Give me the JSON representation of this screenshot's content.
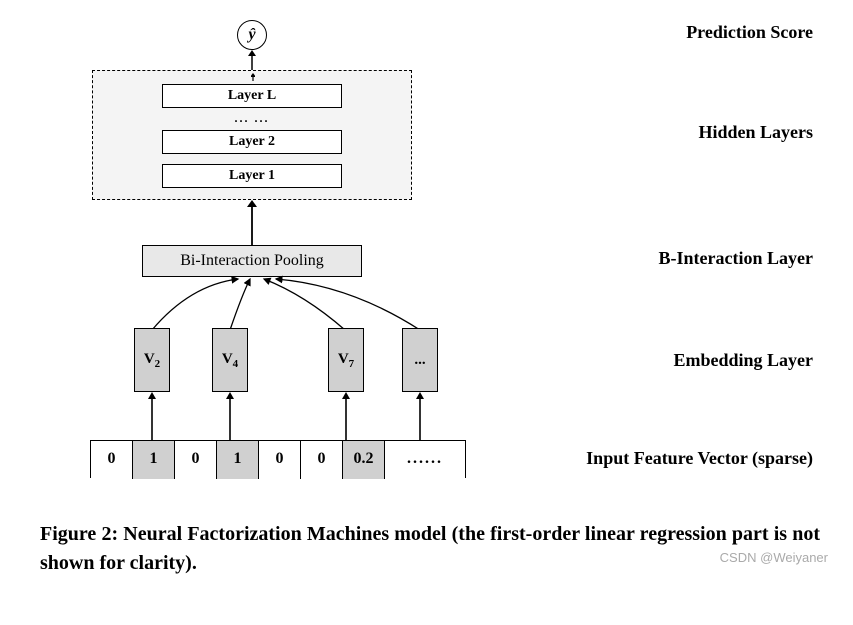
{
  "output": {
    "symbol": "ŷ"
  },
  "hidden": {
    "layerL": "Layer L",
    "dots": "...  ...",
    "layer2": "Layer 2",
    "layer1": "Layer 1"
  },
  "bi": {
    "label": "Bi-Interaction Pooling"
  },
  "embeddings": {
    "v2": "V",
    "v2sub": "2",
    "v4": "V",
    "v4sub": "4",
    "v7": "V",
    "v7sub": "7",
    "vdots": "..."
  },
  "input": {
    "cells": [
      "0",
      "1",
      "0",
      "1",
      "0",
      "0",
      "0.2"
    ],
    "trail": "......"
  },
  "labels": {
    "pred": "Prediction Score",
    "hidden": "Hidden Layers",
    "bi": "B-Interaction Layer",
    "emb": "Embedding Layer",
    "input": "Input Feature Vector (sparse)"
  },
  "caption": "Figure 2: Neural Factorization Machines model (the first-order linear regression part is not shown for clarity).",
  "watermark": "CSDN @Weiyaner"
}
